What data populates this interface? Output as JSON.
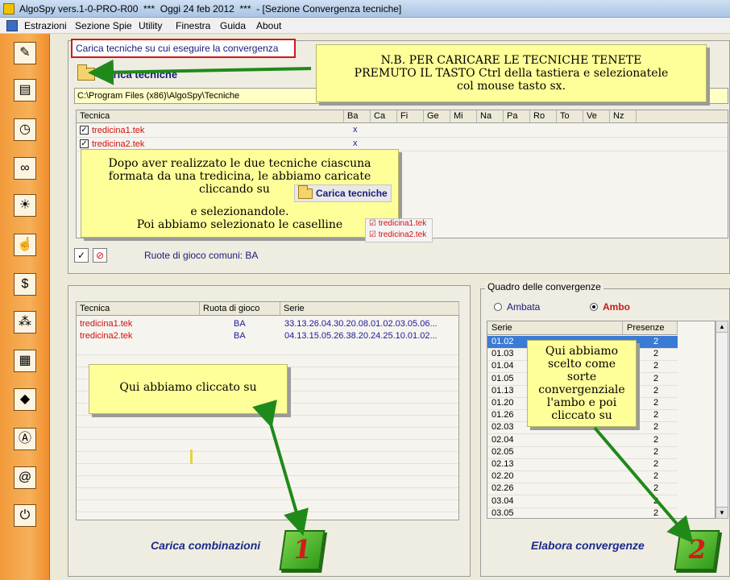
{
  "window": {
    "title": "AlgoSpy vers.1-0-PRO-R00  ***  Oggi 24 feb 2012  ***  - [Sezione Convergenza tecniche]"
  },
  "menu": [
    "Estrazioni",
    "Sezione Spie",
    "Utility",
    "Finestra",
    "Guida",
    "About"
  ],
  "toolbar": {
    "icons": [
      "pencil-icon",
      "book-icon",
      "clock-icon",
      "binoculars-icon",
      "lightbulb-icon",
      "hand-icon",
      "dollar-icon",
      "network-icon",
      "calendar-icon",
      "diamond-icon",
      "letter-a-icon",
      "address-book-icon",
      "power-icon"
    ]
  },
  "top_panel": {
    "caption": "Carica tecniche su cui eseguire la convergenza",
    "load_button": "Carica tecniche",
    "path": "C:\\Program Files (x86)\\AlgoSpy\\Tecniche",
    "columns": [
      "Tecnica",
      "Ba",
      "Ca",
      "Fi",
      "Ge",
      "Mi",
      "Na",
      "Pa",
      "Ro",
      "To",
      "Ve",
      "Nz"
    ],
    "rows": [
      {
        "name": "tredicina1.tek",
        "checked": true,
        "ba": "x"
      },
      {
        "name": "tredicina2.tek",
        "checked": true,
        "ba": "x"
      }
    ],
    "check_btn": "✓",
    "no_btn": "⊘",
    "common_wheels": "Ruote di gioco comuni: BA"
  },
  "combinations": {
    "columns": [
      "Tecnica",
      "Ruota di gioco",
      "Serie"
    ],
    "rows": [
      {
        "tecnica": "tredicina1.tek",
        "ruota": "BA",
        "serie": "33.13.26.04.30.20.08.01.02.03.05.06..."
      },
      {
        "tecnica": "tredicina2.tek",
        "ruota": "BA",
        "serie": "04.13.15.05.26.38.20.24.25.10.01.02..."
      }
    ],
    "action": "Carica combinazioni",
    "badge": "1"
  },
  "convergence": {
    "group_title": "Quadro delle convergenze",
    "radio_ambata": "Ambata",
    "radio_ambo": "Ambo",
    "selected": "Ambo",
    "columns": [
      "Serie",
      "Presenze"
    ],
    "rows": [
      {
        "serie": "01.02",
        "presenze": "2"
      },
      {
        "serie": "01.03",
        "presenze": "2"
      },
      {
        "serie": "01.04",
        "presenze": "2"
      },
      {
        "serie": "01.05",
        "presenze": "2"
      },
      {
        "serie": "01.13",
        "presenze": "2"
      },
      {
        "serie": "01.20",
        "presenze": "2"
      },
      {
        "serie": "01.26",
        "presenze": "2"
      },
      {
        "serie": "02.03",
        "presenze": "2"
      },
      {
        "serie": "02.04",
        "presenze": "2"
      },
      {
        "serie": "02.05",
        "presenze": "2"
      },
      {
        "serie": "02.13",
        "presenze": "2"
      },
      {
        "serie": "02.20",
        "presenze": "2"
      },
      {
        "serie": "02.26",
        "presenze": "2"
      },
      {
        "serie": "03.04",
        "presenze": "2"
      },
      {
        "serie": "03.05",
        "presenze": "2"
      }
    ],
    "action": "Elabora convergenze",
    "badge": "2"
  },
  "notes": {
    "top_right": [
      "N.B. PER CARICARE LE TECNICHE TENETE",
      "PREMUTO IL TASTO Ctrl della tastiera e selezionatele",
      "col mouse tasto sx."
    ],
    "middle": {
      "line1": "Dopo aver realizzato le due tecniche ciascuna",
      "line2": "formata da una tredicina, le abbiamo caricate",
      "line3": "cliccando su",
      "button": "Carica tecniche",
      "line4": "e selezionandole.",
      "line5": "Poi abbiamo selezionato le caselline"
    },
    "bottom_left": "Qui abbiamo cliccato su",
    "bottom_right": [
      "Qui abbiamo",
      "scelto come",
      "sorte",
      "convergenziale",
      "l'ambo e poi",
      "cliccato su"
    ]
  },
  "colors": {
    "accent_red": "#d01010",
    "text_blue": "#1a1a7a",
    "note_yellow": "#ffff99",
    "arrow_green": "#1f8a1a",
    "selection": "#3a7bd5"
  }
}
